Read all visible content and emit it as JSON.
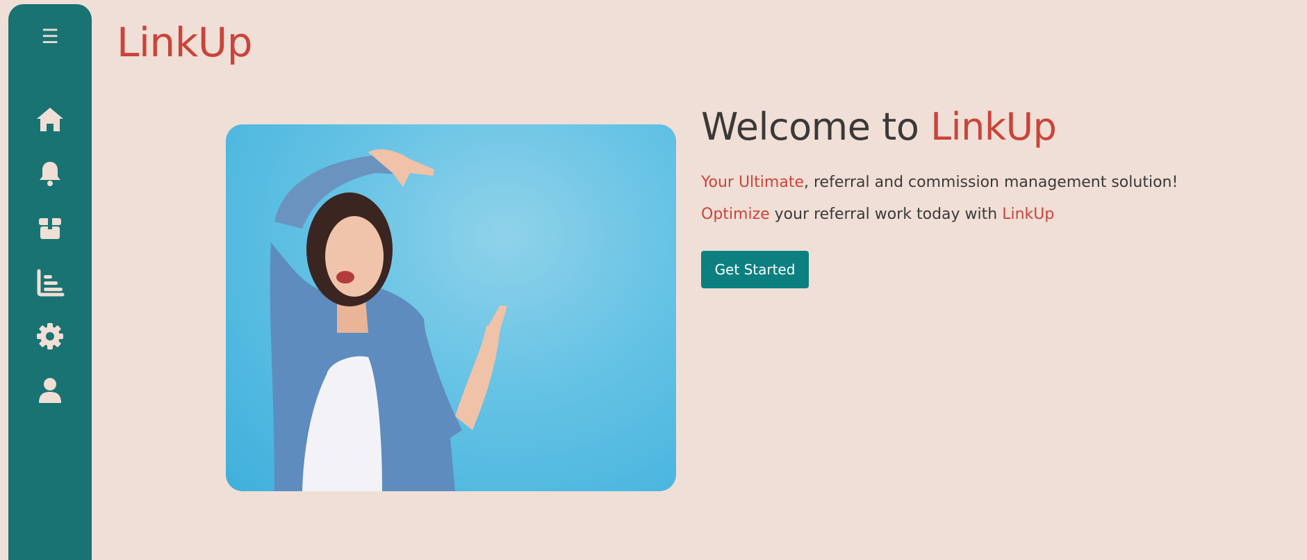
{
  "app": {
    "logo": "LinkUp"
  },
  "sidebar": {
    "menu_icon": "☰",
    "items": [
      {
        "icon": "home-icon"
      },
      {
        "icon": "bell-icon"
      },
      {
        "icon": "box-icon"
      },
      {
        "icon": "bar-chart-icon"
      },
      {
        "icon": "gear-icon"
      },
      {
        "icon": "user-icon"
      }
    ]
  },
  "hero": {
    "welcome_prefix": "Welcome to ",
    "welcome_brand": "LinkUp",
    "line1_accent": "Your Ultimate",
    "line1_rest": ", referral and commission management solution!",
    "line2_accent": "Optimize",
    "line2_mid": " your referral work today with ",
    "line2_brand": "LinkUp",
    "cta_label": "Get Started"
  },
  "colors": {
    "sidebar": "#1a7373",
    "background": "#f0dfd6",
    "accent": "#c9443a",
    "button": "#0c8080"
  }
}
